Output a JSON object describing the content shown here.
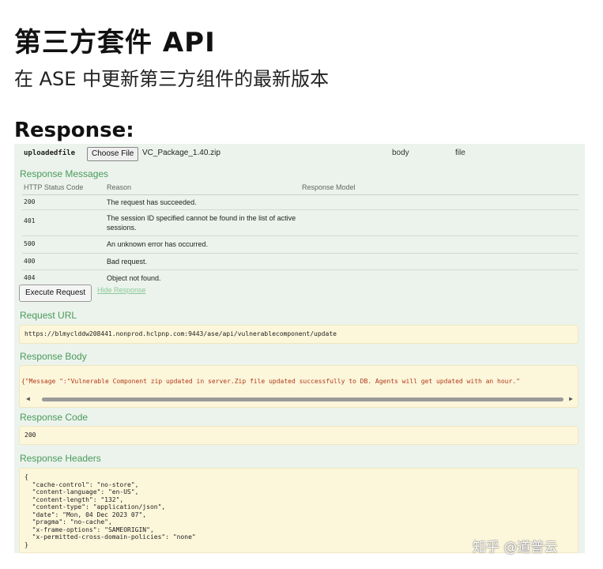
{
  "page": {
    "title": "第三方套件 API",
    "subtitle": "在 ASE 中更新第三方组件的最新版本",
    "response_heading": "Response:"
  },
  "parameter": {
    "name": "uploadedfile",
    "choose_file_label": "Choose File",
    "file_name": "VC_Package_1.40.zip",
    "param_type": "body",
    "data_type": "file"
  },
  "response_messages": {
    "heading": "Response Messages",
    "columns": [
      "HTTP Status Code",
      "Reason",
      "Response Model"
    ],
    "rows": [
      {
        "code": "200",
        "reason": "The request has succeeded."
      },
      {
        "code": "401",
        "reason": "The session ID specified cannot be found in the list of active sessions."
      },
      {
        "code": "500",
        "reason": "An unknown error has occurred."
      },
      {
        "code": "400",
        "reason": "Bad request."
      },
      {
        "code": "404",
        "reason": "Object not found."
      }
    ]
  },
  "actions": {
    "execute_label": "Execute Request",
    "hide_label": "Hide Response"
  },
  "request_url": {
    "heading": "Request URL",
    "value": "https://blmyclddw208441.nonprod.hclpnp.com:9443/ase/api/vulnerablecomponent/update"
  },
  "response_body": {
    "heading": "Response Body",
    "value": "{\"Message \":\"Vulnerable Component zip updated in server.Zip file updated successfully to DB. Agents will get updated with an hour.\""
  },
  "response_code": {
    "heading": "Response Code",
    "value": "200"
  },
  "response_headers": {
    "heading": "Response Headers",
    "value": "{\n  \"cache-control\": \"no-store\",\n  \"content-language\": \"en-US\",\n  \"content-length\": \"132\",\n  \"content-type\": \"application/json\",\n  \"date\": \"Mon, 04 Dec 2023 07\",\n  \"pragma\": \"no-cache\",\n  \"x-frame-options\": \"SAMEORIGIN\",\n  \"x-permitted-cross-domain-policies\": \"none\"\n}"
  },
  "watermark": "知乎 @道普云"
}
